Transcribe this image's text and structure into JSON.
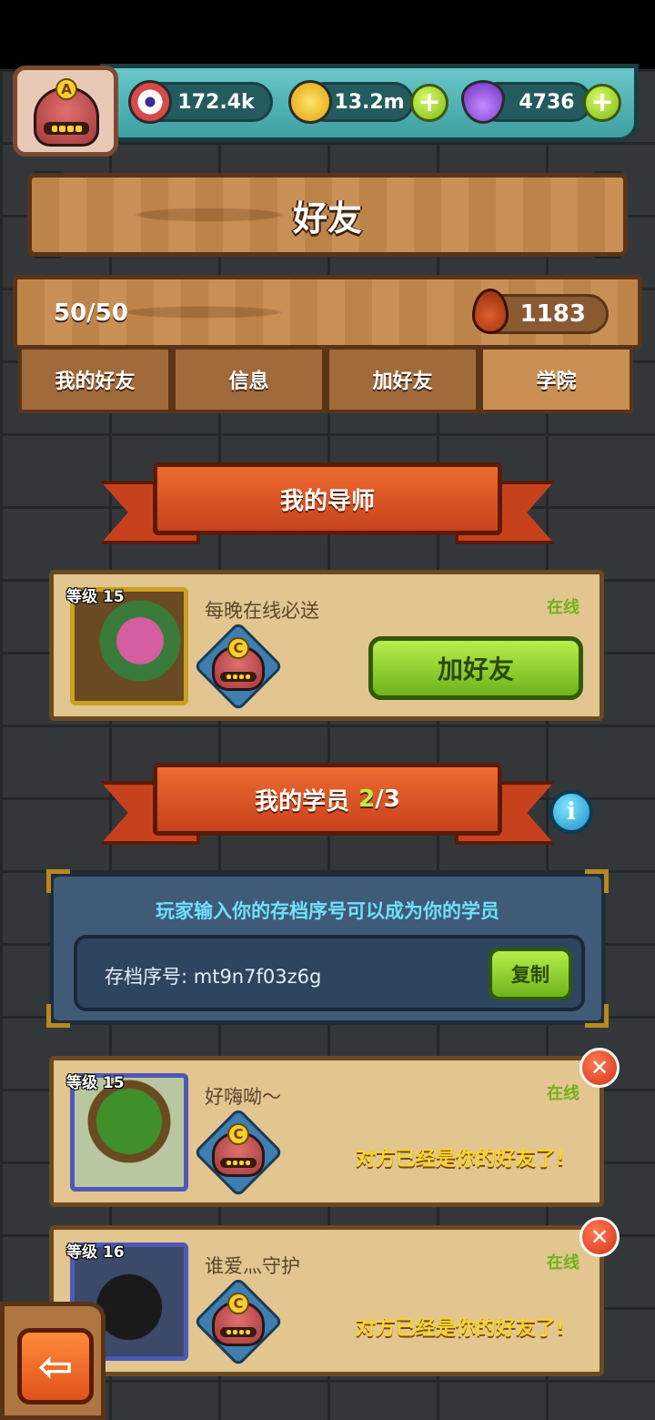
{
  "resources": {
    "eyes": "172.4k",
    "coins": "13.2m",
    "potions": "4736"
  },
  "profile": {
    "rank_letter": "A"
  },
  "title": "好友",
  "friend_count": "50/50",
  "drops": "1183",
  "tabs": [
    "我的好友",
    "信息",
    "加好友",
    "学院"
  ],
  "active_tab": "学院",
  "mentor_section": {
    "title": "我的导师",
    "card": {
      "level": "等级 15",
      "message": "每晚在线必送",
      "status": "在线",
      "rank_letter": "C",
      "button": "加好友"
    }
  },
  "students_section": {
    "title": "我的学员",
    "count_current": "2",
    "count_total": "/3"
  },
  "code_panel": {
    "title": "玩家输入你的存档序号可以成为你的学员",
    "label": "存档序号: mt9n7f03z6g",
    "copy_button": "复制"
  },
  "students": [
    {
      "level": "等级 15",
      "message": "好嗨呦～",
      "status": "在线",
      "rank_letter": "C",
      "note": "对方已经是你的好友了!"
    },
    {
      "level": "等级 16",
      "message": "谁爱灬守护",
      "status": "在线",
      "rank_letter": "C",
      "note": "对方已经是你的好友了!"
    }
  ],
  "colors": {
    "accent_green": "#6fb31a",
    "ribbon_red": "#c7421c",
    "online_green": "#6fb31a",
    "note_yellow": "#f7d530",
    "teal_bar": "#4fb4b8"
  }
}
